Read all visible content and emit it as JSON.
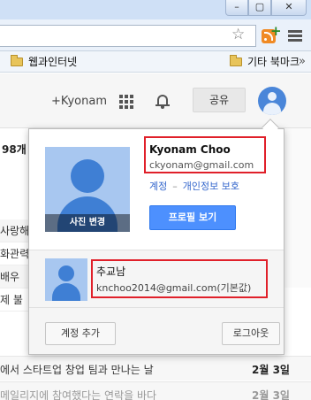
{
  "browser": {
    "window_controls": {
      "minimize": "–",
      "maximize": "▢",
      "close": "✕"
    },
    "bookmarks": [
      {
        "label": "웹과인터넷"
      },
      {
        "label": "기타 북마크"
      }
    ],
    "bookmarks_more": "»"
  },
  "gmail": {
    "username": "+Kyonam",
    "share_label": "공유",
    "count_fragment": "98개",
    "left_fragments": [
      "사랑해",
      "화관력",
      "배우",
      "제 불"
    ],
    "rows": [
      {
        "subject": "에서 스타트업 창업 팀과 만나는 날",
        "date": "2월 3일"
      },
      {
        "subject": "메일리지에 참여했다는 연락을 바다",
        "date": "2월 3일"
      }
    ]
  },
  "popup": {
    "primary": {
      "name": "Kyonam Choo",
      "email": "ckyonam@gmail.com",
      "photo_change": "사진 변경",
      "account_link": "계정",
      "link_separator": "–",
      "privacy_link": "개인정보 보호",
      "profile_button": "프로필 보기"
    },
    "secondary": {
      "name": "추교남",
      "email": "knchoo2014@gmail.com(기본값)"
    },
    "add_account": "계정 추가",
    "logout": "로그아웃"
  },
  "colors": {
    "accent_blue": "#4d90fe",
    "highlight_red": "#e0202a",
    "link_blue": "#3366cc"
  }
}
